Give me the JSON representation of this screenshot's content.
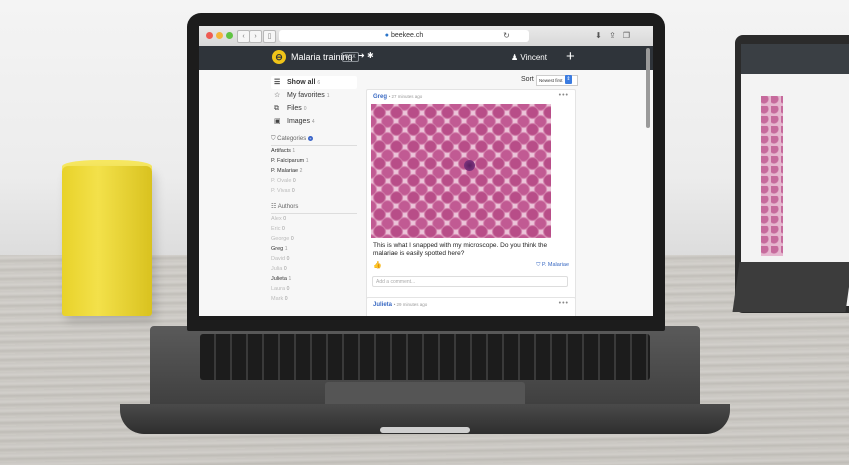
{
  "browser": {
    "url": "beekee.ch",
    "icons": [
      "back-icon",
      "forward-icon",
      "sidebar-icon",
      "reload-icon",
      "download-icon",
      "share-icon",
      "tabs-icon"
    ]
  },
  "header": {
    "title": "Malaria training",
    "badge": "BOX",
    "user": "Vincent",
    "add": "+"
  },
  "sidebar": {
    "show_all": "Show all",
    "show_all_count": "6",
    "favorites": "My favorites",
    "favorites_count": "1",
    "files": "Files",
    "files_count": "0",
    "images": "Images",
    "images_count": "4",
    "categories_title": "Categories",
    "categories_badge": "+",
    "categories": [
      {
        "name": "Artifacts",
        "count": "1",
        "muted": false
      },
      {
        "name": "P. Falciparum",
        "count": "1",
        "muted": false
      },
      {
        "name": "P. Malariae",
        "count": "2",
        "muted": false
      },
      {
        "name": "P. Ovale",
        "count": "0",
        "muted": true
      },
      {
        "name": "P. Vivax",
        "count": "0",
        "muted": true
      }
    ],
    "authors_title": "Authors",
    "authors": [
      {
        "name": "Alex",
        "count": "0",
        "muted": true
      },
      {
        "name": "Eric",
        "count": "0",
        "muted": true
      },
      {
        "name": "George",
        "count": "0",
        "muted": true
      },
      {
        "name": "Greg",
        "count": "1",
        "muted": false
      },
      {
        "name": "David",
        "count": "0",
        "muted": true
      },
      {
        "name": "Julia",
        "count": "0",
        "muted": true
      },
      {
        "name": "Julieta",
        "count": "1",
        "muted": false
      },
      {
        "name": "Laura",
        "count": "0",
        "muted": true
      },
      {
        "name": "Mark",
        "count": "0",
        "muted": true
      }
    ]
  },
  "feed": {
    "sort_label": "Sort",
    "sort_value": "Newest first",
    "posts": [
      {
        "author": "Greg",
        "time": "• 27 minutes ago",
        "text": "This is what I snapped with my microscope. Do you think the malariae is easily spotted here?",
        "tag": "P. Malariae",
        "comment_placeholder": "Add a comment..."
      },
      {
        "author": "Julieta",
        "time": "• 29 minutes ago"
      }
    ]
  }
}
